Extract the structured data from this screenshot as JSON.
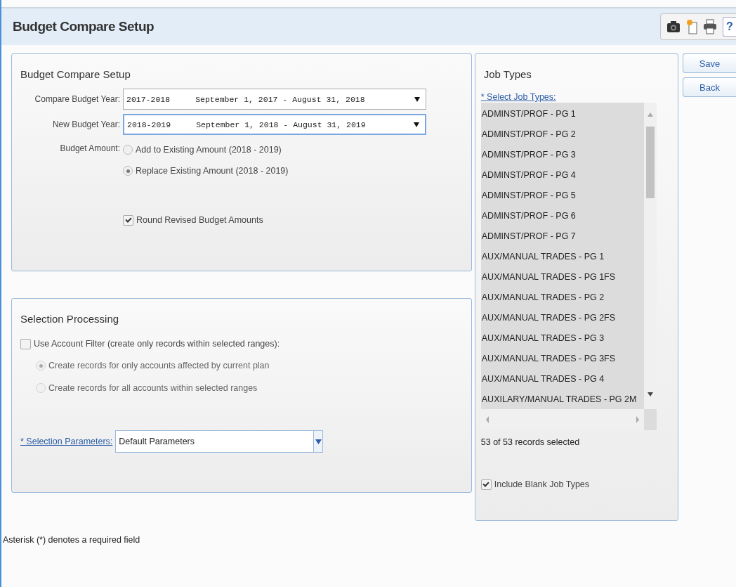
{
  "page": {
    "title": "Budget Compare Setup",
    "help_label": "?"
  },
  "setup": {
    "title": "Budget Compare Setup",
    "fields": [
      {
        "label": "Compare Budget Year:",
        "year": "2017-2018",
        "range": "September 1, 2017 - August 31, 2018",
        "focused": false
      },
      {
        "label": "New Budget Year:",
        "year": "2018-2019",
        "range": "September 1, 2018 - August 31, 2019",
        "focused": true
      }
    ],
    "amount_label": "Budget Amount:",
    "amount_options": [
      {
        "label": "Add to Existing Amount (2018 - 2019)",
        "selected": false
      },
      {
        "label": "Replace Existing Amount (2018 - 2019)",
        "selected": true
      }
    ],
    "round": {
      "label": "Round Revised Budget Amounts",
      "checked": true
    }
  },
  "selection": {
    "title": "Selection Processing",
    "filter": {
      "label": "Use Account Filter (create only records within selected ranges):",
      "checked": false
    },
    "options": [
      {
        "label": "Create records for only accounts affected by current plan",
        "selected": true,
        "disabled": true
      },
      {
        "label": "Create records for all accounts within selected ranges",
        "selected": false,
        "disabled": true
      }
    ],
    "parameters_label": "* Selection Parameters:",
    "parameters_value": "Default Parameters"
  },
  "footer": "Asterisk (*) denotes a required field",
  "job_types": {
    "title": "Job Types",
    "select_label": "* Select Job Types:",
    "items": [
      {
        "label": "ADMINST/PROF - PG 1",
        "selected": true
      },
      {
        "label": "ADMINST/PROF - PG 2",
        "selected": true
      },
      {
        "label": "ADMINST/PROF - PG 3",
        "selected": true
      },
      {
        "label": "ADMINST/PROF - PG 4",
        "selected": true
      },
      {
        "label": "ADMINST/PROF - PG 5",
        "selected": true
      },
      {
        "label": "ADMINST/PROF - PG 6",
        "selected": true
      },
      {
        "label": "ADMINST/PROF - PG 7",
        "selected": true
      },
      {
        "label": "AUX/MANUAL TRADES - PG 1",
        "selected": true
      },
      {
        "label": "AUX/MANUAL TRADES - PG 1FS",
        "selected": true
      },
      {
        "label": "AUX/MANUAL TRADES - PG 2",
        "selected": true
      },
      {
        "label": "AUX/MANUAL TRADES - PG 2FS",
        "selected": true
      },
      {
        "label": "AUX/MANUAL TRADES - PG 3",
        "selected": true
      },
      {
        "label": "AUX/MANUAL TRADES - PG 3FS",
        "selected": true
      },
      {
        "label": "AUX/MANUAL TRADES - PG 4",
        "selected": true
      },
      {
        "label": "AUXILARY/MANUAL TRADES - PG 2M",
        "selected": true
      }
    ],
    "count": "53 of 53 records selected",
    "include_blank": {
      "label": "Include Blank Job Types",
      "checked": true
    }
  },
  "buttons": [
    {
      "label": "Save"
    },
    {
      "label": "Back"
    }
  ]
}
